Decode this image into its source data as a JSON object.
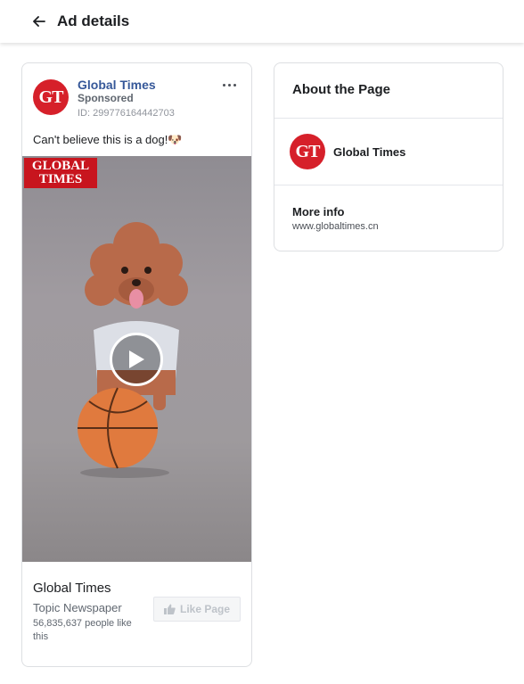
{
  "header": {
    "title": "Ad details",
    "back_icon": "back-arrow-icon"
  },
  "ad": {
    "page_name": "Global Times",
    "sponsored_label": "Sponsored",
    "ad_id": "ID: 299776164442703",
    "logo_text": "GT",
    "more_icon": "more-options-icon",
    "text": "Can't believe this is a dog!🐶",
    "media": {
      "logo_line1": "GLOBAL",
      "logo_line2": "TIMES",
      "play_icon": "play-icon"
    },
    "footer": {
      "title": "Global Times",
      "category": "Topic Newspaper",
      "likes": "56,835,637 people like this",
      "like_button_label": "Like Page",
      "like_icon": "thumbs-up-icon"
    }
  },
  "about": {
    "title": "About the Page",
    "page_name": "Global Times",
    "logo_text": "GT",
    "more_info_label": "More info",
    "more_info_url": "www.globaltimes.cn"
  },
  "colors": {
    "brand_red": "#d6202a",
    "link_blue": "#365899"
  }
}
